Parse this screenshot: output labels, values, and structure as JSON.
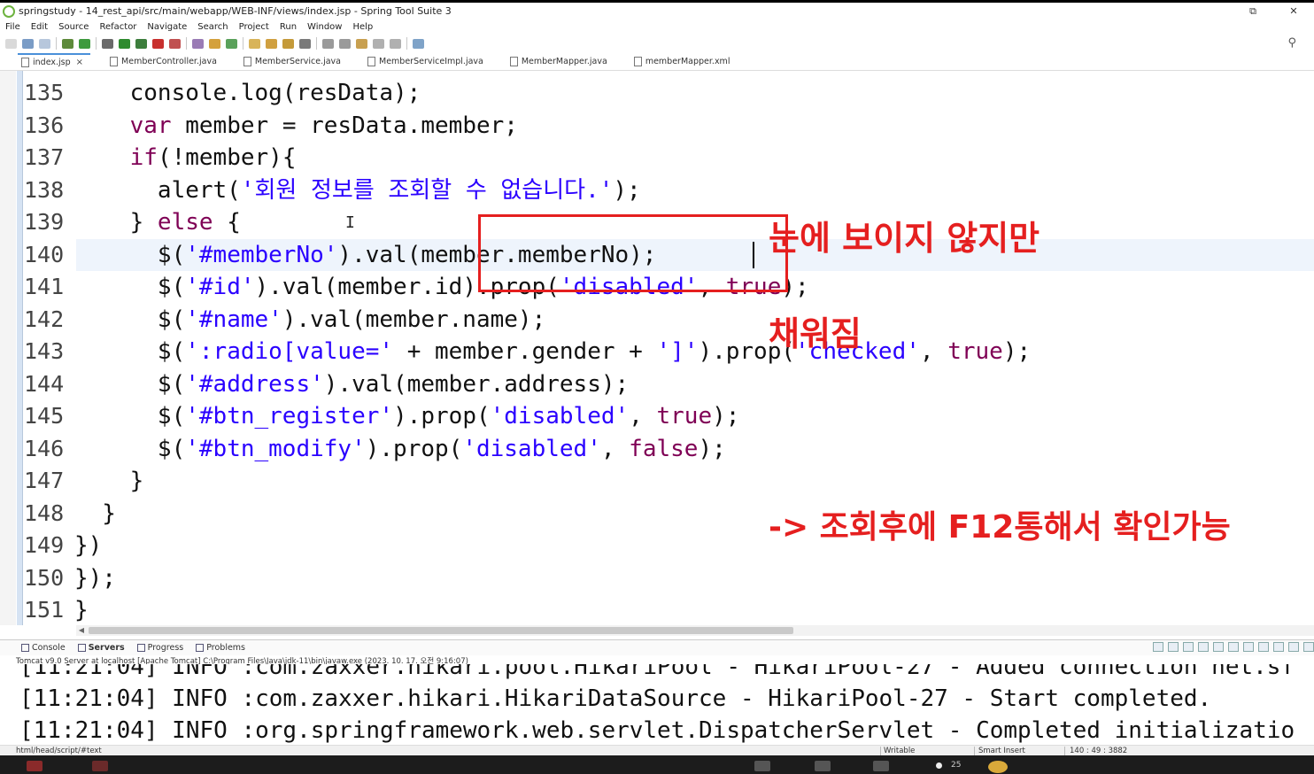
{
  "window": {
    "title": "springstudy - 14_rest_api/src/main/webapp/WEB-INF/views/index.jsp - Spring Tool Suite 3",
    "restore_glyph": "⧉",
    "close_glyph": "✕"
  },
  "menu": [
    "File",
    "Edit",
    "Source",
    "Refactor",
    "Navigate",
    "Search",
    "Project",
    "Run",
    "Window",
    "Help"
  ],
  "editor_tabs": [
    {
      "label": "index.jsp",
      "close": "×"
    },
    {
      "label": "MemberController.java"
    },
    {
      "label": "MemberService.java"
    },
    {
      "label": "MemberServiceImpl.java"
    },
    {
      "label": "MemberMapper.java"
    },
    {
      "label": "memberMapper.xml"
    }
  ],
  "code_lines": [
    {
      "num": "135",
      "code": "    console.log(resData);"
    },
    {
      "num": "136",
      "code": "    var member = resData.member;"
    },
    {
      "num": "137",
      "code": "    if(!member){"
    },
    {
      "num": "138",
      "code": "      alert('회원 정보를 조회할 수 없습니다.');"
    },
    {
      "num": "139",
      "code": "    } else {"
    },
    {
      "num": "140",
      "code": "      $('#memberNo').val(member.memberNo);"
    },
    {
      "num": "141",
      "code": "      $('#id').val(member.id).prop('disabled', true);"
    },
    {
      "num": "142",
      "code": "      $('#name').val(member.name);"
    },
    {
      "num": "143",
      "code": "      $(':radio[value=' + member.gender + ']').prop('checked', true);"
    },
    {
      "num": "144",
      "code": "      $('#address').val(member.address);"
    },
    {
      "num": "145",
      "code": "      $('#btn_register').prop('disabled', true);"
    },
    {
      "num": "146",
      "code": "      $('#btn_modify').prop('disabled', false);"
    },
    {
      "num": "147",
      "code": "    }"
    },
    {
      "num": "148",
      "code": "  }"
    },
    {
      "num": "149",
      "code": "})"
    },
    {
      "num": "150",
      "code": "});"
    },
    {
      "num": "151",
      "code": "}"
    }
  ],
  "annotations": {
    "a1": "눈에 보이지 않지만",
    "a2": "채워짐",
    "a3": "-> 조회후에 F12통해서 확인가능"
  },
  "console": {
    "tabs": [
      "Console",
      "Servers",
      "Progress",
      "Problems"
    ],
    "description": "Tomcat v9.0 Server at localhost [Apache Tomcat] C:\\Program Files\\Java\\jdk-11\\bin\\javaw.exe  (2023. 10. 17. 오전 9:16:07)",
    "lines": [
      "[11:21:04] INFO :com.zaxxer.hikari.pool.HikariPool - HikariPool-27 - Added connection net.sf",
      "[11:21:04] INFO :com.zaxxer.hikari.HikariDataSource - HikariPool-27 - Start completed.",
      "[11:21:04] INFO :org.springframework.web.servlet.DispatcherServlet - Completed initializatio"
    ]
  },
  "status": {
    "path": "html/head/script/#text",
    "writable": "Writable",
    "insert_mode": "Smart Insert",
    "position": "140 : 49 : 3882"
  },
  "taskbar": {
    "count": "25"
  },
  "colors": {
    "annotation_red": "#e51f1f",
    "keyword": "#7f0055",
    "string": "#2a00ff",
    "active_tab": "#4a90d9"
  }
}
